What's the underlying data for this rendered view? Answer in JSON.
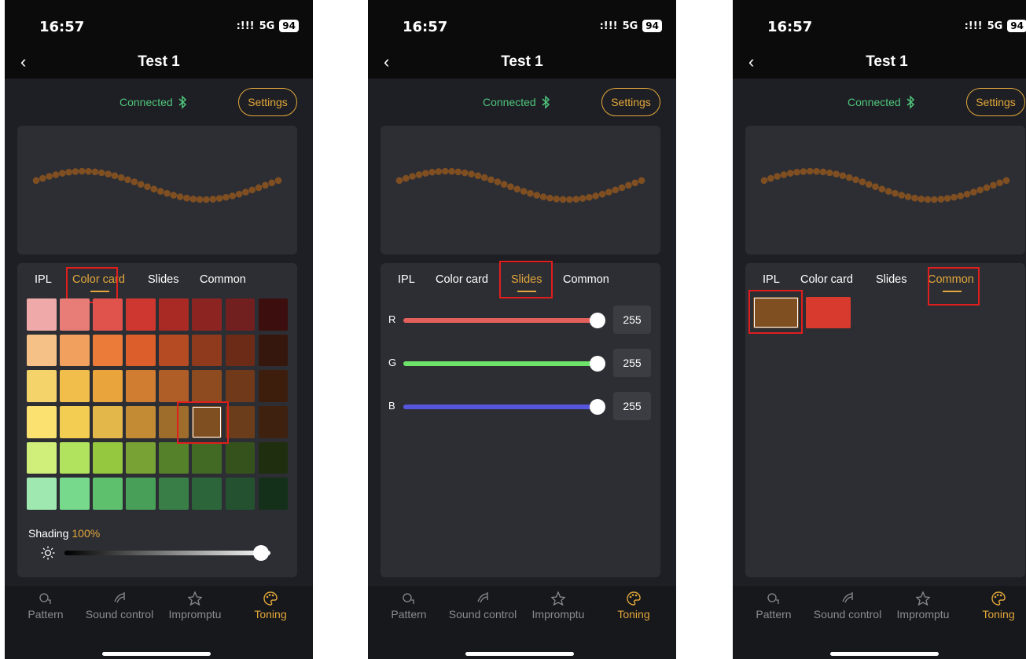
{
  "status_bar": {
    "time": "16:57",
    "signal": ":!!!",
    "network": "5G",
    "battery": "94"
  },
  "header": {
    "title": "Test 1"
  },
  "connection": {
    "text": "Connected"
  },
  "settings_label": "Settings",
  "tabs": [
    "IPL",
    "Color card",
    "Slides",
    "Common"
  ],
  "screens": [
    {
      "active_tab": "Color card"
    },
    {
      "active_tab": "Slides"
    },
    {
      "active_tab": "Common"
    }
  ],
  "light_color": "#7f4f22",
  "accent_color": "#e2a73a",
  "connected_color": "#4ec47b",
  "color_card": {
    "rows": [
      [
        "#f0a9a9",
        "#e87c77",
        "#e0524c",
        "#cd3730",
        "#a92a25",
        "#8c2421",
        "#721f1f",
        "#3c0e0e"
      ],
      [
        "#f5c186",
        "#f1a05e",
        "#ea7b39",
        "#dc5e2a",
        "#b44b22",
        "#8f3a1c",
        "#6c2b17",
        "#36170e"
      ],
      [
        "#f4d36a",
        "#f1bd4b",
        "#e9a53c",
        "#d07d31",
        "#b05e27",
        "#8e4b1f",
        "#70391a",
        "#3d1e0d"
      ],
      [
        "#fbe16f",
        "#f3cd52",
        "#e4b74a",
        "#c48b35",
        "#9f6d2b",
        "#7f4f22",
        "#6c3d1a",
        "#3e220f"
      ],
      [
        "#cfef7a",
        "#b2e35e",
        "#95c83f",
        "#78a233",
        "#56812b",
        "#436a25",
        "#35521d",
        "#1f2e0f"
      ],
      [
        "#9fe8b0",
        "#76d98b",
        "#5ebf6c",
        "#48a058",
        "#397d47",
        "#2d653a",
        "#24512f",
        "#14301b"
      ]
    ],
    "selected": {
      "row": 3,
      "col": 5
    }
  },
  "shading": {
    "label": "Shading",
    "value": "100%",
    "level": 1.0
  },
  "slides": [
    {
      "label": "R",
      "value": "255",
      "level": 1.0,
      "color": "#e3605c"
    },
    {
      "label": "G",
      "value": "255",
      "level": 1.0,
      "color": "#6ee36a"
    },
    {
      "label": "B",
      "value": "255",
      "level": 1.0,
      "color": "#5556dc"
    }
  ],
  "common_colors": [
    "#7f4f22",
    "#d93a2e"
  ],
  "nav": [
    {
      "label": "Pattern",
      "icon": "pattern-icon"
    },
    {
      "label": "Sound control",
      "icon": "sound-icon"
    },
    {
      "label": "Impromptu",
      "icon": "impromptu-icon"
    },
    {
      "label": "Toning",
      "icon": "palette-icon",
      "active": true
    }
  ]
}
